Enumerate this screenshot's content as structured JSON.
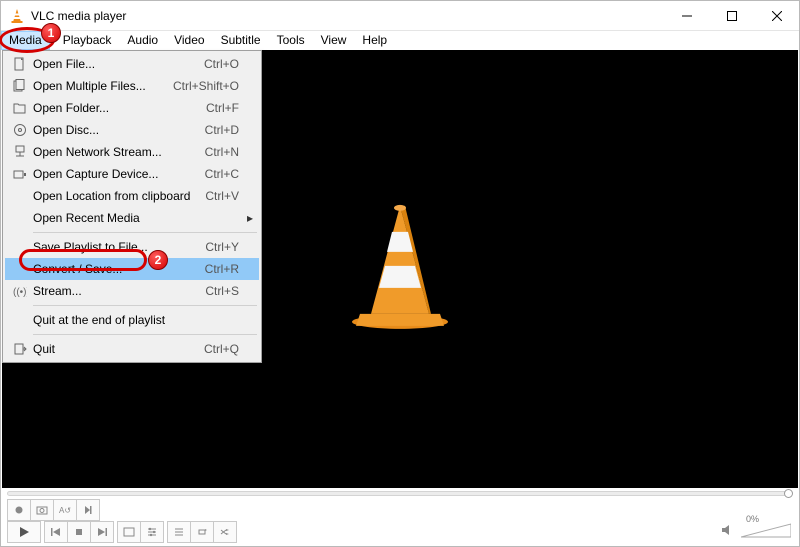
{
  "window": {
    "title": "VLC media player"
  },
  "menubar": {
    "items": [
      {
        "label": "Media",
        "active": true
      },
      {
        "label": "Playback",
        "active": false
      },
      {
        "label": "Audio",
        "active": false
      },
      {
        "label": "Video",
        "active": false
      },
      {
        "label": "Subtitle",
        "active": false
      },
      {
        "label": "Tools",
        "active": false
      },
      {
        "label": "View",
        "active": false
      },
      {
        "label": "Help",
        "active": false
      }
    ]
  },
  "dropdown": {
    "groups": [
      [
        {
          "icon": "file",
          "label": "Open File...",
          "shortcut": "Ctrl+O"
        },
        {
          "icon": "files",
          "label": "Open Multiple Files...",
          "shortcut": "Ctrl+Shift+O"
        },
        {
          "icon": "folder",
          "label": "Open Folder...",
          "shortcut": "Ctrl+F"
        },
        {
          "icon": "disc",
          "label": "Open Disc...",
          "shortcut": "Ctrl+D"
        },
        {
          "icon": "network",
          "label": "Open Network Stream...",
          "shortcut": "Ctrl+N"
        },
        {
          "icon": "capture",
          "label": "Open Capture Device...",
          "shortcut": "Ctrl+C"
        },
        {
          "icon": "",
          "label": "Open Location from clipboard",
          "shortcut": "Ctrl+V"
        },
        {
          "icon": "",
          "label": "Open Recent Media",
          "shortcut": "",
          "submenu": true
        }
      ],
      [
        {
          "icon": "",
          "label": "Save Playlist to File...",
          "shortcut": "Ctrl+Y"
        },
        {
          "icon": "",
          "label": "Convert / Save...",
          "shortcut": "Ctrl+R",
          "selected": true
        },
        {
          "icon": "stream",
          "label": "Stream...",
          "shortcut": "Ctrl+S"
        }
      ],
      [
        {
          "icon": "",
          "label": "Quit at the end of playlist",
          "shortcut": ""
        }
      ],
      [
        {
          "icon": "quit",
          "label": "Quit",
          "shortcut": "Ctrl+Q"
        }
      ]
    ]
  },
  "annotations": {
    "one": "1",
    "two": "2"
  },
  "controls": {
    "volume_percent": "0%"
  }
}
